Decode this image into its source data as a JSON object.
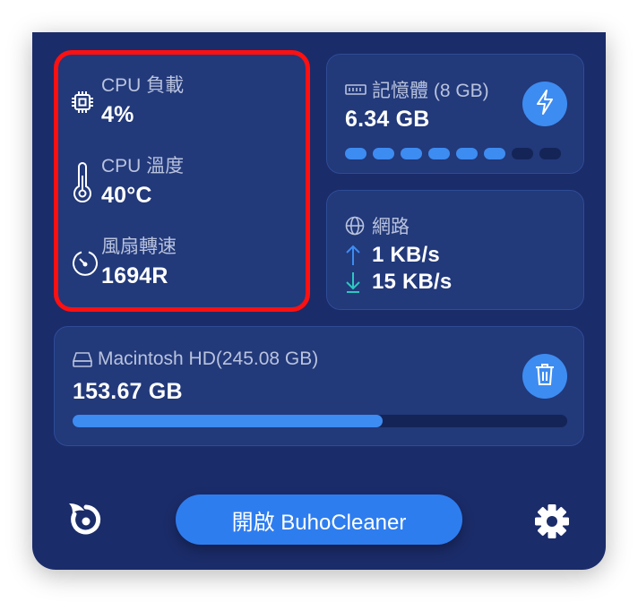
{
  "cpu": {
    "load_label": "CPU 負載",
    "load_value": "4%",
    "temp_label": "CPU 溫度",
    "temp_value": "40°C",
    "fan_label": "風扇轉速",
    "fan_value": "1694R"
  },
  "memory": {
    "label": "記憶體 (8 GB)",
    "value": "6.34 GB",
    "level_dots_filled": 6,
    "level_dots_total": 8,
    "action_icon": "lightning-icon"
  },
  "network": {
    "label": "網路",
    "upload": "1 KB/s",
    "download": "15 KB/s"
  },
  "disk": {
    "label": "Macintosh HD(245.08 GB)",
    "value": "153.67 GB",
    "used_fraction": 0.627,
    "action_icon": "trash-icon"
  },
  "footer": {
    "open_button": "開啟 BuhoCleaner",
    "logo_icon": "buho-logo-icon",
    "settings_icon": "gear-icon"
  },
  "colors": {
    "panel_bg": "#1b2c6a",
    "card_bg": "#22397a",
    "accent": "#3d8cf1",
    "highlight": "#ff1010",
    "download_arrow": "#2ec7c0"
  }
}
